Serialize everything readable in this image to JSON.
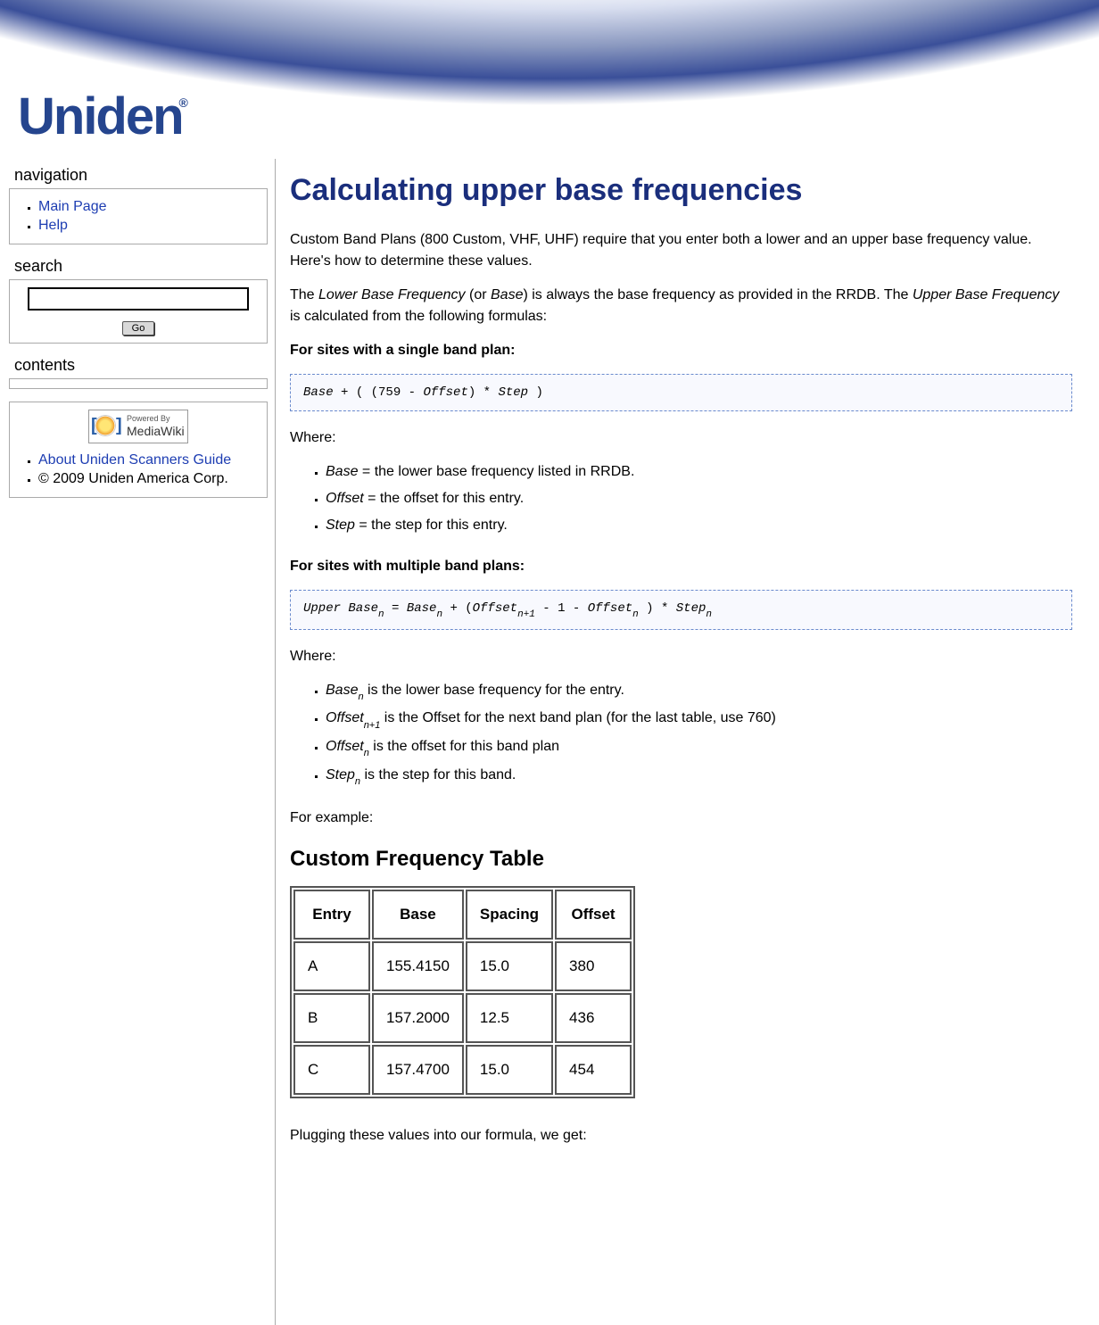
{
  "logo_text": "Uniden",
  "nav": {
    "title": "navigation",
    "items": [
      {
        "label": "Main Page"
      },
      {
        "label": "Help"
      }
    ]
  },
  "search": {
    "title": "search",
    "value": "",
    "go_label": "Go"
  },
  "contents": {
    "title": "contents"
  },
  "about": {
    "powered_top": "Powered By",
    "powered_name": "MediaWiki",
    "items": [
      {
        "label": "About Uniden Scanners Guide",
        "link": true
      },
      {
        "label": "© 2009 Uniden America Corp.",
        "link": false
      }
    ]
  },
  "article": {
    "title": "Calculating upper base frequencies",
    "intro1": "Custom Band Plans (800 Custom, VHF, UHF) require that you enter both a lower and an upper base frequency value. Here's how to determine these values.",
    "intro2_pre": "The ",
    "intro2_i1": "Lower Base Frequency",
    "intro2_mid1": " (or ",
    "intro2_i2": "Base",
    "intro2_mid2": ") is always the base frequency as provided in the RRDB. The ",
    "intro2_i3": "Upper Base Frequency",
    "intro2_post": " is calculated from the following formulas:",
    "single_hdr": "For sites with a single band plan:",
    "formula1": {
      "base": "Base",
      "plus": " + ( (759 - ",
      "offset": "Offset",
      "mid": ") * ",
      "step": "Step",
      "end": " )"
    },
    "where": "Where:",
    "single_defs": [
      {
        "term": "Base",
        "text": " = the lower base frequency listed in RRDB."
      },
      {
        "term": "Offset",
        "text": " = the offset for this entry."
      },
      {
        "term": "Step",
        "text": " = the step for this entry."
      }
    ],
    "multi_hdr": "For sites with multiple band plans:",
    "formula2": {
      "a": "Upper Base",
      "b": " = ",
      "c": "Base",
      "d": " + (",
      "e": "Offset",
      "f": " - 1 - ",
      "g": "Offset",
      "h": " ) * ",
      "i": "Step",
      "sub_n": "n",
      "sub_np1": "n+1"
    },
    "multi_defs": [
      {
        "term": "Base",
        "sub": "n",
        "text": " is the lower base frequency for the entry."
      },
      {
        "term": "Offset",
        "sub": "n+1",
        "text": " is the Offset for the next band plan (for the last table, use 760)"
      },
      {
        "term": "Offset",
        "sub": "n",
        "text": " is the offset for this band plan"
      },
      {
        "term": "Step",
        "sub": "n",
        "text": " is the step for this band."
      }
    ],
    "for_example": "For example:",
    "table": {
      "title": "Custom Frequency Table",
      "headers": [
        "Entry",
        "Base",
        "Spacing",
        "Offset"
      ],
      "rows": [
        [
          "A",
          "155.4150",
          "15.0",
          "380"
        ],
        [
          "B",
          "157.2000",
          "12.5",
          "436"
        ],
        [
          "C",
          "157.4700",
          "15.0",
          "454"
        ]
      ]
    },
    "plugging": "Plugging these values into our formula, we get:"
  },
  "chart_data": {
    "type": "table",
    "title": "Custom Frequency Table",
    "columns": [
      "Entry",
      "Base",
      "Spacing",
      "Offset"
    ],
    "rows": [
      {
        "Entry": "A",
        "Base": 155.415,
        "Spacing": 15.0,
        "Offset": 380
      },
      {
        "Entry": "B",
        "Base": 157.2,
        "Spacing": 12.5,
        "Offset": 436
      },
      {
        "Entry": "C",
        "Base": 157.47,
        "Spacing": 15.0,
        "Offset": 454
      }
    ]
  }
}
